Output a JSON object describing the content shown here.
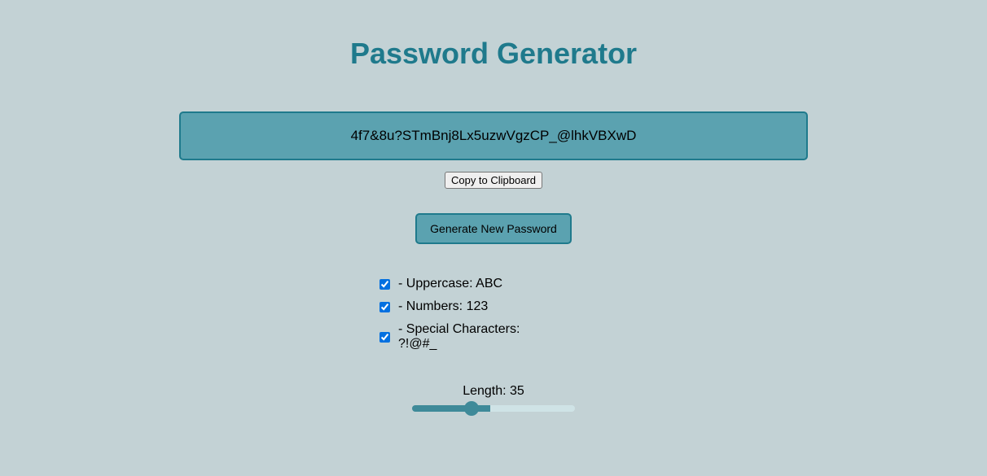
{
  "title": "Password Generator",
  "password": "4f7&8u?STmBnj8Lx5uzwVgzCP_@lhkVBXwD",
  "copy_label": "Copy to Clipboard",
  "generate_label": "Generate New Password",
  "options": {
    "uppercase": {
      "label": " - Uppercase: ABC",
      "checked": true
    },
    "numbers": {
      "label": " - Numbers: 123",
      "checked": true
    },
    "special": {
      "label": " - Special Characters: ?!@#_",
      "checked": true
    }
  },
  "length": {
    "prefix": "Length: ",
    "value": "35",
    "min": "8",
    "max": "64"
  }
}
